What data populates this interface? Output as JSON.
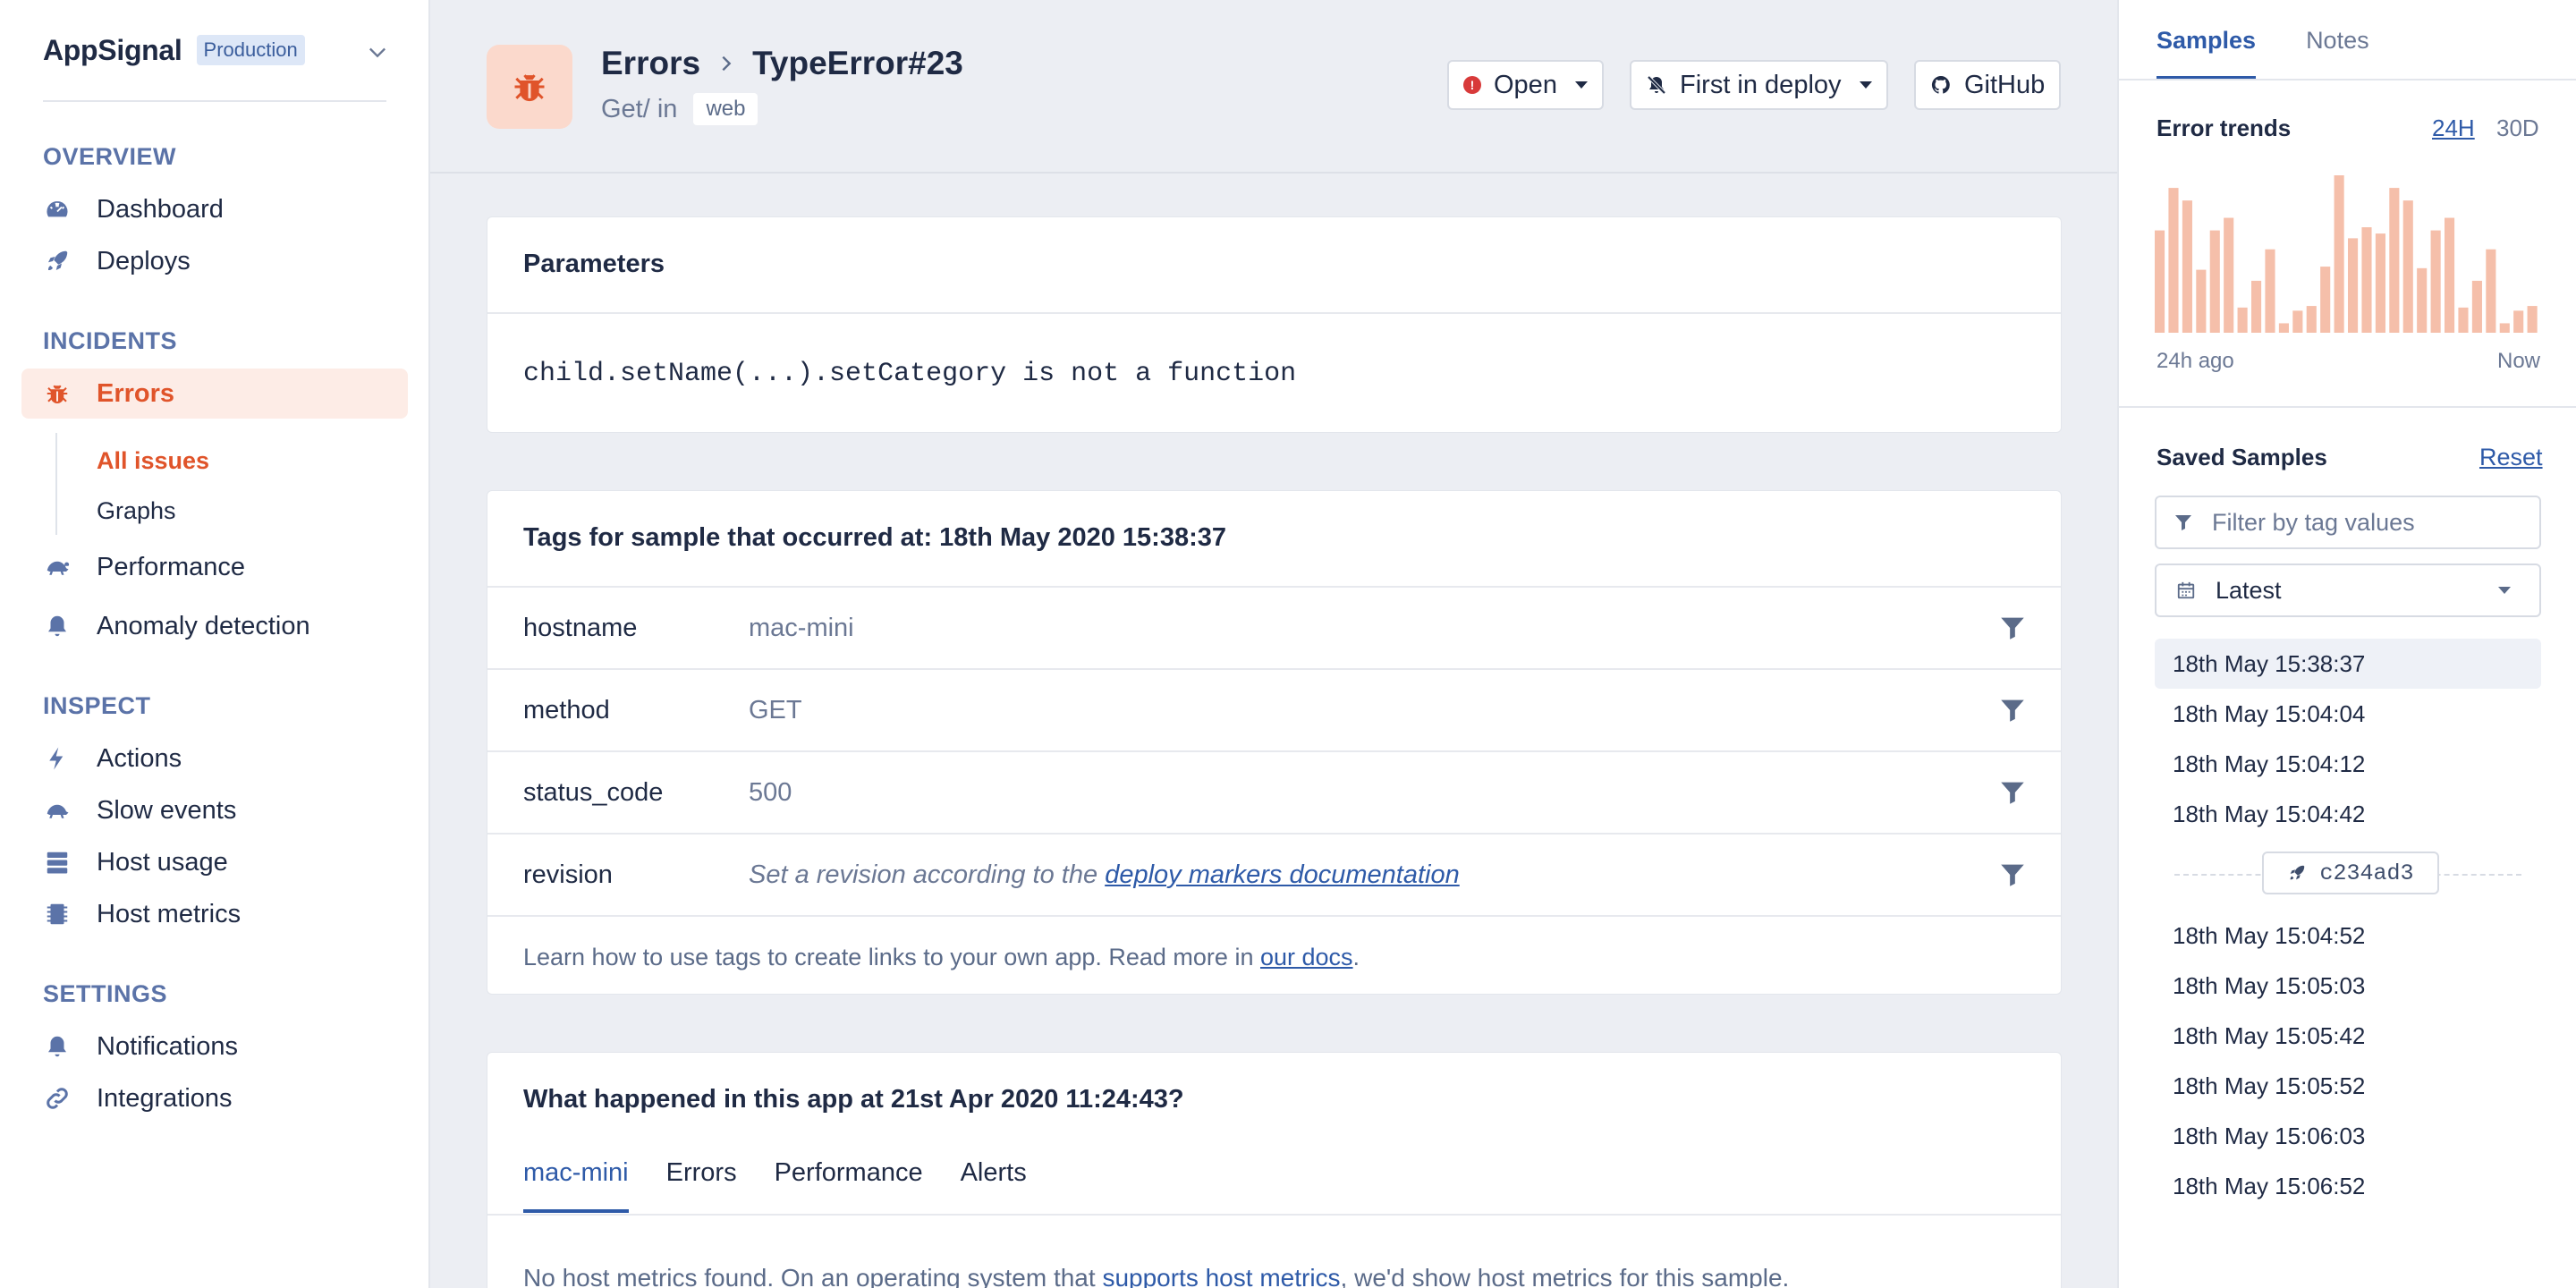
{
  "brand": {
    "name": "AppSignal",
    "environment": "Production"
  },
  "sidebar": {
    "sections": [
      {
        "title": "OVERVIEW"
      },
      {
        "title": "INCIDENTS"
      },
      {
        "title": "INSPECT"
      },
      {
        "title": "SETTINGS"
      }
    ],
    "overview": [
      {
        "label": "Dashboard",
        "icon": "gauge-icon"
      },
      {
        "label": "Deploys",
        "icon": "rocket-icon"
      }
    ],
    "incidents": [
      {
        "label": "Errors",
        "icon": "bug-icon",
        "active": true
      },
      {
        "label": "Performance",
        "icon": "turtle-icon"
      },
      {
        "label": "Anomaly detection",
        "icon": "bell-icon"
      }
    ],
    "errors_sub": [
      {
        "label": "All issues",
        "active": true
      },
      {
        "label": "Graphs"
      }
    ],
    "inspect": [
      {
        "label": "Actions",
        "icon": "bolt-icon"
      },
      {
        "label": "Slow events",
        "icon": "turtle-icon"
      },
      {
        "label": "Host usage",
        "icon": "server-icon"
      },
      {
        "label": "Host metrics",
        "icon": "chip-icon"
      }
    ],
    "settings": [
      {
        "label": "Notifications",
        "icon": "bell-icon"
      },
      {
        "label": "Integrations",
        "icon": "link-icon"
      }
    ]
  },
  "header": {
    "breadcrumb_root": "Errors",
    "breadcrumb_current": "TypeError#23",
    "action_name": "Get/ in",
    "namespace": "web",
    "status_label": "Open",
    "deploy_label": "First in deploy",
    "github_label": "GitHub"
  },
  "parameters": {
    "title": "Parameters",
    "message": "child.setName(...).setCategory is not a function"
  },
  "tags": {
    "title": "Tags for sample that occurred at: 18th May 2020 15:38:37",
    "rows": [
      {
        "key": "hostname",
        "value": "mac-mini"
      },
      {
        "key": "method",
        "value": "GET"
      },
      {
        "key": "status_code",
        "value": "500"
      }
    ],
    "revision_key": "revision",
    "revision_text": "Set a revision according to the",
    "revision_link": "deploy markers documentation",
    "footer_text": "Learn how to use tags to create links to your own app. Read more in",
    "footer_link": "our docs",
    "footer_end": "."
  },
  "happened": {
    "title": "What happened in this app at 21st Apr 2020 11:24:43?",
    "tabs": [
      "mac-mini",
      "Errors",
      "Performance",
      "Alerts"
    ],
    "message_start": "No host metrics found. On an operating system that",
    "message_link": "supports host metrics",
    "message_end": ", we'd show host metrics for this sample."
  },
  "right_panel": {
    "tabs": [
      "Samples",
      "Notes"
    ],
    "trends_title": "Error trends",
    "ranges": [
      "24H",
      "30D"
    ],
    "axis_start": "24h ago",
    "axis_end": "Now",
    "saved_title": "Saved Samples",
    "reset_label": "Reset",
    "filter_placeholder": "Filter by tag values",
    "select_value": "Latest",
    "samples_before": [
      "18th May 15:38:37",
      "18th May 15:04:04",
      "18th May 15:04:12",
      "18th May 15:04:42"
    ],
    "deploy_revision": "c234ad3",
    "samples_after": [
      "18th May 15:04:52",
      "18th May 15:05:03",
      "18th May 15:05:42",
      "18th May 15:05:52",
      "18th May 15:06:03",
      "18th May 15:06:52"
    ]
  },
  "chart_data": {
    "type": "bar",
    "title": "Error trends",
    "xlabel": "",
    "ylabel": "",
    "x_start_label": "24h ago",
    "x_end_label": "Now",
    "ylim": [
      0,
      100
    ],
    "values": [
      65,
      92,
      84,
      40,
      65,
      73,
      16,
      33,
      53,
      6,
      14,
      17,
      42,
      100,
      60,
      67,
      63,
      92,
      84,
      41,
      65,
      73,
      16,
      33,
      53,
      6,
      14,
      17
    ]
  },
  "colors": {
    "accent": "#e0542a",
    "link": "#2e5aa8",
    "bar": "#f5bfaa"
  }
}
